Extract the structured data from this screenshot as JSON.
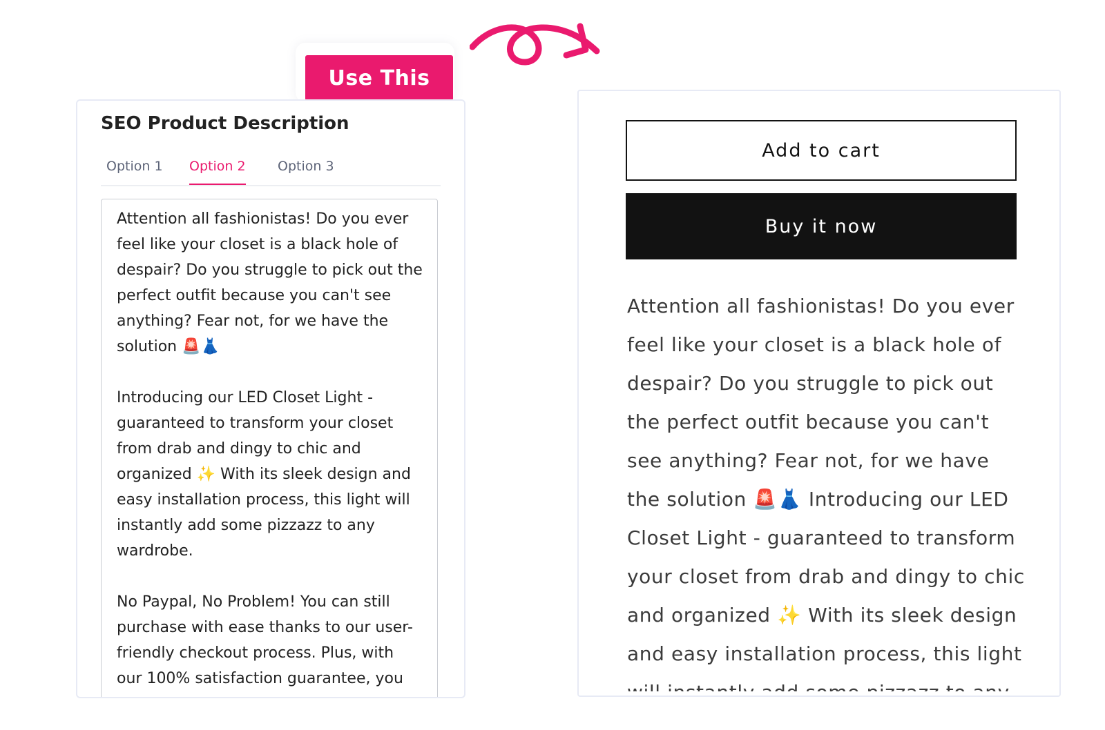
{
  "use_button": {
    "label": "Use This",
    "color": "#ea1a6e"
  },
  "arrow": {
    "icon": "curly-arrow-right-icon",
    "color": "#ea1a6e"
  },
  "left_panel": {
    "title": "SEO Product Description",
    "tabs": [
      {
        "label": "Option 1",
        "active": false
      },
      {
        "label": "Option 2",
        "active": true
      },
      {
        "label": "Option 3",
        "active": false
      }
    ],
    "description_paragraphs": [
      "Attention all fashionistas! Do you ever feel like your closet is a black hole of despair? Do you struggle to pick out the perfect outfit because you can't see anything? Fear not, for we have the solution 🚨👗",
      "Introducing our LED Closet Light - guaranteed to transform your closet from drab and dingy to chic and organized ✨ With its sleek design and easy installation process, this light will instantly add some pizzazz to any wardrobe.",
      "No Paypal, No Problem! You can still purchase with ease thanks to our user-friendly checkout process. Plus, with our 100% satisfaction guarantee, you"
    ]
  },
  "right_panel": {
    "add_to_cart": "Add to cart",
    "buy_now": "Buy it now",
    "description": "Attention all fashionistas! Do you ever feel like your closet is a black hole of despair? Do you struggle to pick out the perfect outfit because you can't see anything? Fear not, for we have the solution 🚨👗 Introducing our LED Closet Light - guaranteed to transform your closet from drab and dingy to chic and organized ✨ With its sleek design and easy installation process, this light will instantly add some pizzazz to any"
  }
}
